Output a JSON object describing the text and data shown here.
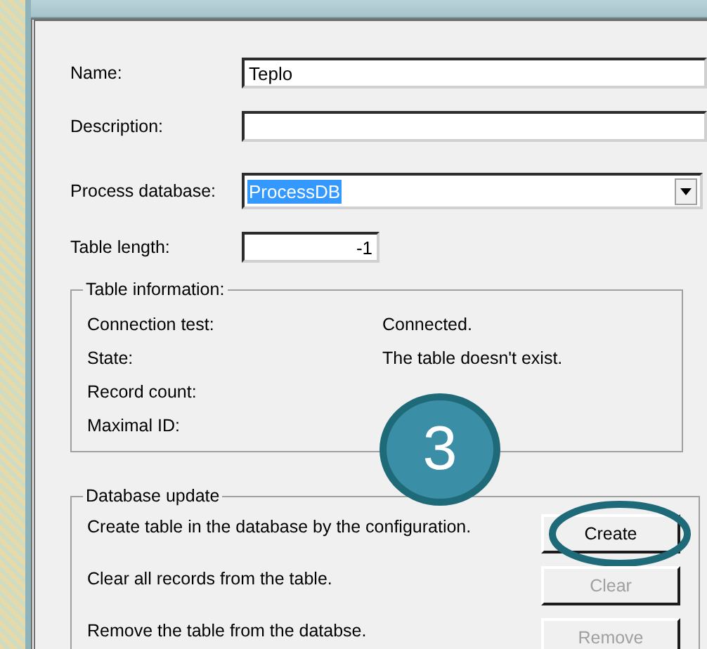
{
  "form": {
    "fields": [
      {
        "kind": "text",
        "label": "Name:",
        "value": "Teplo"
      },
      {
        "kind": "text",
        "label": "Description:"
      },
      {
        "kind": "select",
        "label": "Process database:",
        "value": "ProcessDB",
        "text_selected": true
      },
      {
        "kind": "number",
        "label": "Table length:",
        "value": "-1"
      }
    ]
  },
  "table_information": {
    "title": "Table information:",
    "rows": [
      {
        "label": "Connection test:",
        "value": "Connected."
      },
      {
        "label": "State:",
        "value": "The table doesn't exist."
      },
      {
        "label": "Record count:"
      },
      {
        "label": "Maximal ID:"
      }
    ]
  },
  "database_update": {
    "title": "Database update",
    "actions": [
      {
        "description": "Create table in the database by the configuration.",
        "button": "Create",
        "disabled": false,
        "circled": true
      },
      {
        "description": "Clear all records from the table.",
        "button": "Clear",
        "disabled": true,
        "circled": false
      },
      {
        "description": "Remove the table from the databse.",
        "button": "Remove",
        "disabled": true,
        "circled": false
      }
    ]
  },
  "callout": {
    "number": "3"
  }
}
